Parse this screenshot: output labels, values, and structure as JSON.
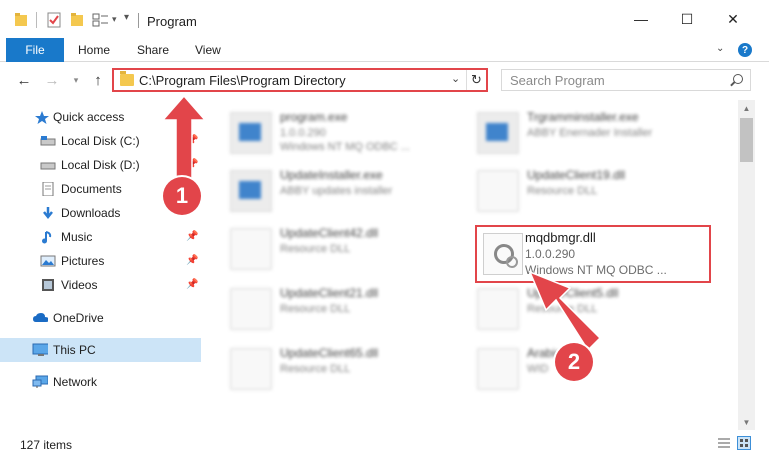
{
  "window": {
    "title": "Program",
    "minimize_glyph": "—",
    "maximize_glyph": "☐",
    "close_glyph": "✕"
  },
  "ribbon": {
    "file": "File",
    "home": "Home",
    "share": "Share",
    "view": "View",
    "help_glyph": "?"
  },
  "address": {
    "path": "C:\\Program Files\\Program Directory",
    "search_placeholder": "Search Program"
  },
  "nav": {
    "items": [
      {
        "label": "Quick access",
        "icon": "star-icon"
      },
      {
        "label": "Local Disk (C:)",
        "icon": "drive-icon"
      },
      {
        "label": "Local Disk (D:)",
        "icon": "drive-icon"
      },
      {
        "label": "Documents",
        "icon": "documents-icon"
      },
      {
        "label": "Downloads",
        "icon": "downloads-icon"
      },
      {
        "label": "Music",
        "icon": "music-icon"
      },
      {
        "label": "Pictures",
        "icon": "pictures-icon"
      },
      {
        "label": "Videos",
        "icon": "videos-icon"
      },
      {
        "label": "OneDrive",
        "icon": "cloud-icon"
      },
      {
        "label": "This PC",
        "icon": "computer-icon"
      },
      {
        "label": "Network",
        "icon": "network-icon"
      }
    ]
  },
  "files": [
    {
      "name": "program.exe",
      "line1": "1.0.0.290",
      "line2": "Windows NT MQ ODBC ..."
    },
    {
      "name": "Trgramminstaller.exe",
      "line1": "ABBY Enernader Installer",
      "line2": ""
    },
    {
      "name": "UpdateInstaller.exe",
      "line1": "ABBY updates installer",
      "line2": ""
    },
    {
      "name": "UpdateClient19.dll",
      "line1": "Resource DLL",
      "line2": ""
    },
    {
      "name": "UpdateClient42.dll",
      "line1": "Resource DLL",
      "line2": ""
    },
    {
      "name": "UpdateClient21.dll",
      "line1": "Resource DLL",
      "line2": ""
    },
    {
      "name": "UpdateClient5.dll",
      "line1": "Resource DLL",
      "line2": ""
    },
    {
      "name": "UpdateClient65.dll",
      "line1": "Resource DLL",
      "line2": ""
    },
    {
      "name": "Arabic",
      "line1": "WID",
      "line2": ""
    }
  ],
  "highlighted_file": {
    "name": "mqdbmgr.dll",
    "version": "1.0.0.290",
    "description": "Windows NT MQ ODBC ..."
  },
  "status": {
    "count": "127 items"
  },
  "callouts": {
    "one": "1",
    "two": "2"
  },
  "colors": {
    "accent": "#1979ca",
    "highlight": "#e2454a",
    "selected": "#cce4f7"
  }
}
